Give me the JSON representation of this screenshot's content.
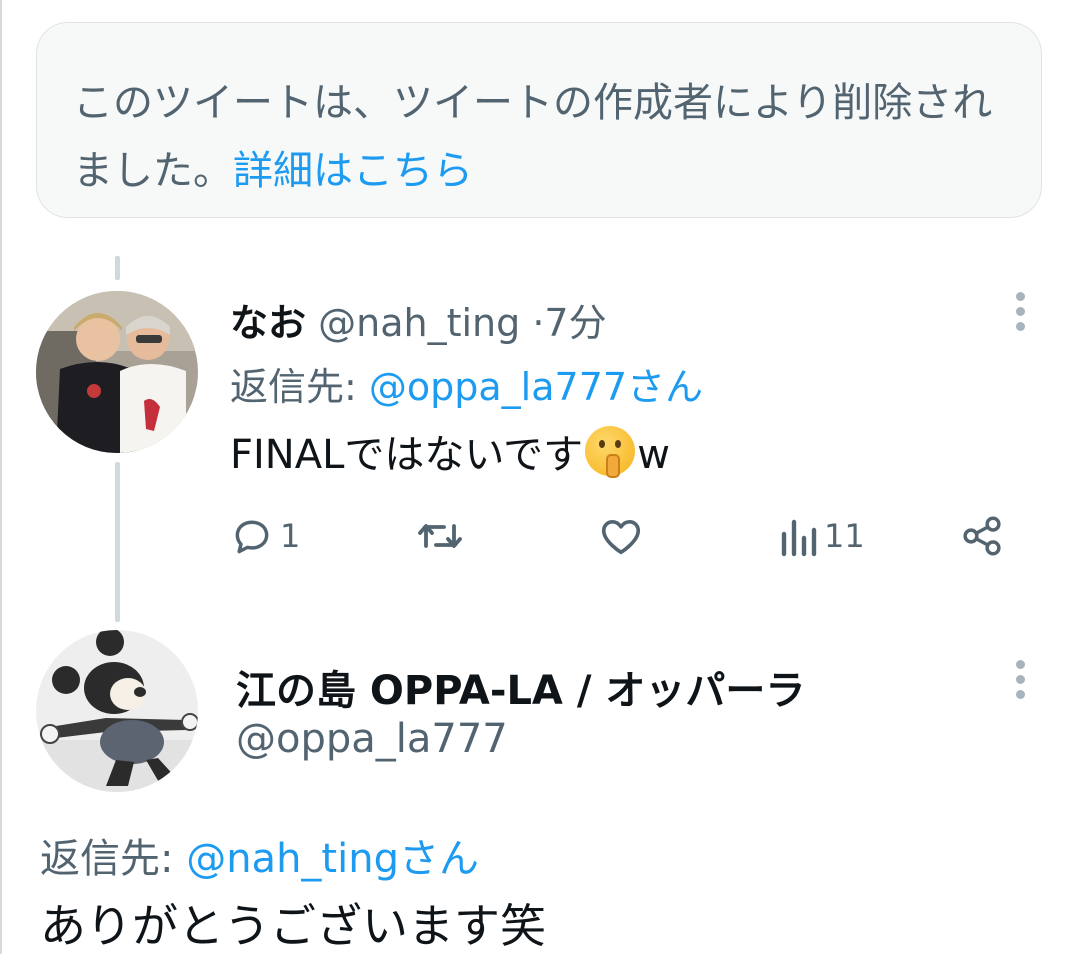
{
  "deleted_notice": {
    "text": "このツイートは、ツイートの作成者により削除されました。",
    "link": "詳細はこちら"
  },
  "tweets": [
    {
      "name": "なお",
      "handle": "@nah_ting",
      "separator": "·",
      "time": "7分",
      "reply_label": "返信先: ",
      "reply_to": "@oppa_la777さん",
      "text_before": "FINALではないです",
      "emoji": "shushing-face-icon",
      "text_after": "w",
      "actions": {
        "reply_count": "1",
        "retweet_count": "",
        "like_count": "",
        "views_count": "11"
      }
    },
    {
      "name": "江の島 OPPA-LA / オッパーラ",
      "handle": "@oppa_la777",
      "reply_label": "返信先: ",
      "reply_to": "@nah_tingさん",
      "text": "ありがとうございます笑"
    }
  ],
  "colors": {
    "accent": "#1d9bf0",
    "secondary_text": "#536471",
    "primary_text": "#0f1419",
    "thread_line": "#cfd9de",
    "notice_bg": "#f7f9f9"
  }
}
